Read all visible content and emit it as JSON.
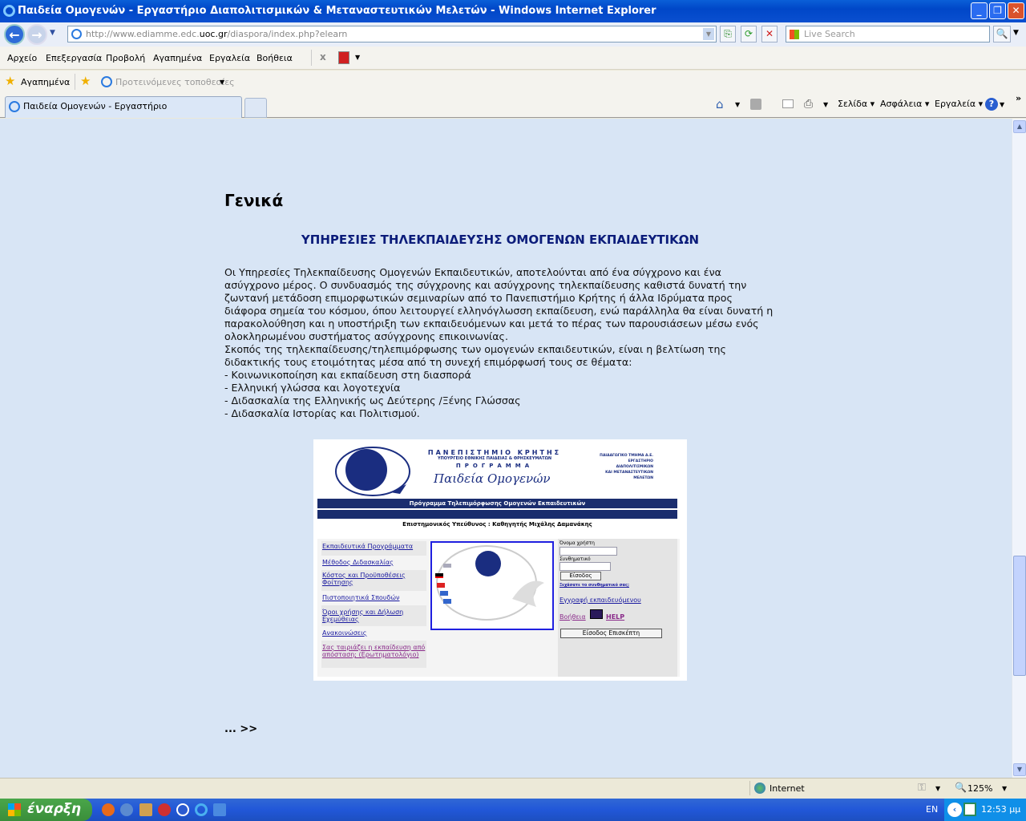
{
  "window": {
    "title": "Παιδεία Ομογενών - Εργαστήριο Διαπολιτισμικών & Μεταναστευτικών Μελετών - Windows Internet Explorer"
  },
  "address": {
    "url_prefix": "http://www.ediamme.edc.",
    "url_domain": "uoc.gr",
    "url_suffix": "/diaspora/index.php?elearn",
    "search_placeholder": "Live Search"
  },
  "menu": [
    "Αρχείο",
    "Επεξεργασία",
    "Προβολή",
    "Αγαπημένα",
    "Εργαλεία",
    "Βοήθεια"
  ],
  "favorites": {
    "label": "Αγαπημένα",
    "suggested": "Προτεινόμενες τοποθεσίες"
  },
  "tab": {
    "label": "Παιδεία Ομογενών - Εργαστήριο Διαπολιτισμικών & Με..."
  },
  "commandbar": {
    "page": "Σελίδα",
    "safety": "Ασφάλεια",
    "tools": "Εργαλεία",
    "more": "»"
  },
  "page": {
    "title": "Γενικά",
    "subheading": "ΥΠΗΡΕΣΙΕΣ ΤΗΛΕΚΠΑΙΔΕΥΣΗΣ ΟΜΟΓΕΝΩΝ ΕΚΠΑΙΔΕΥΤΙΚΩΝ",
    "paragraph1": "Οι Υπηρεσίες Τηλεκπαίδευσης Ομογενών Εκπαιδευτικών, αποτελούνται από ένα σύγχρονο και ένα ασύγχρονο μέρος. Ο συνδυασμός της σύγχρονης και ασύγχρονης τηλεκπαίδευσης καθιστά δυνατή την ζωντανή μετάδοση επιμορφωτικών σεμιναρίων από το Πανεπιστήμιο Κρήτης ή άλλα Ιδρύματα προς διάφορα σημεία του κόσμου, όπου λειτουργεί ελληνόγλωσση εκπαίδευση, ενώ παράλληλα θα είναι δυνατή η παρακολούθηση και η υποστήριξη των εκπαιδευόμενων και μετά το πέρας των παρουσιάσεων μέσω ενός ολοκληρωμένου συστήματος ασύγχρονης επικοινωνίας.",
    "paragraph2": "Σκοπός της τηλεκπαίδευσης/τηλεπιμόρφωσης των ομογενών εκπαιδευτικών, είναι η βελτίωση της διδακτικής τους ετοιμότητας μέσα από τη συνεχή επιμόρφωσή τους σε θέματα:",
    "topics": [
      "- Κοινωνικοποίηση και εκπαίδευση στη διασπορά",
      "- Ελληνική γλώσσα και λογοτεχνία",
      "- Διδασκαλία της Ελληνικής ως Δεύτερης /Ξένης Γλώσσας",
      "- Διδασκαλία Ιστορίας και Πολιτισμού."
    ],
    "more_link": "... >>"
  },
  "banner": {
    "university": "ΠΑΝΕΠΙΣΤΗΜΙΟ ΚΡΗΤΗΣ",
    "ministry": "ΥΠΟΥΡΓΕΙΟ ΕΘΝΙΚΗΣ ΠΑΙΔΕΙΑΣ & ΘΡΗΣΚΕΥΜΑΤΩΝ",
    "programme": "ΠΡΟΓΡΑΜΜΑ",
    "logo_script": "Παιδεία Ομογενών",
    "dept": [
      "ΠΑΙΔΑΓΩΓΙΚΟ ΤΜΗΜΑ Δ.Ε.",
      "ΕΡΓΑΣΤΗΡΙΟ",
      "ΔΙΑΠΟΛΙΤΙΣΜΙΚΩΝ",
      "ΚΑΙ ΜΕΤΑΝΑΣΤΕΥΤΙΚΩΝ",
      "ΜΕΛΕΤΩΝ"
    ],
    "bar_title": "Πρόγραμμα Τηλεπιμόρφωσης Ομογενών Εκπαιδευτικών",
    "supervisor": "Επιστημονικός Υπεύθυνος : Καθηγητής Μιχάλης Δαμανάκης",
    "links": [
      "Εκπαιδευτικά Προγράμματα",
      "Μέθοδος Διδασκαλίας",
      "Κόστος και Προϋποθέσεις Φοίτησης",
      "Πιστοποιητικά Σπουδών",
      "Όροι χρήσης και Δήλωση Εχεμύθειας",
      "Ανακοινώσεις",
      "Σας ταιριάζει η εκπαίδευση από απόσταση; (Ερωτηματολόγιο)"
    ],
    "username_label": "Όνομα χρήστη",
    "password_label": "Συνθηματικό",
    "login": "Είσοδος",
    "forgot": "Ξεχάσατε το συνθηματικό σας;",
    "register": "Εγγραφή εκπαιδευόμενου",
    "help": "Βοήθεια",
    "help_en": "HELP",
    "guest": "Είσοδος Επισκέπτη"
  },
  "status": {
    "zone": "Internet",
    "zoom": "125%"
  },
  "taskbar": {
    "start": "έναρξη",
    "lang": "EN",
    "clock": "12:53 μμ"
  }
}
